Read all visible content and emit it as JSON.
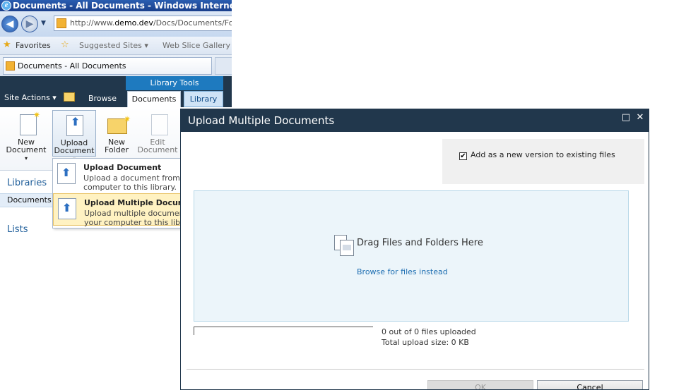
{
  "browser": {
    "title": "Documents - All Documents - Windows Internet Explorer",
    "address": {
      "prefix": "http://www.",
      "domain": "demo.dev",
      "path": "/Docs/Documents/Forms/"
    },
    "favorites": {
      "label": "Favorites",
      "suggested": "Suggested Sites",
      "webslice": "Web Slice Gallery"
    },
    "tab": {
      "label": "Documents - All Documents"
    }
  },
  "ribbon": {
    "site_actions": "Site Actions",
    "contextual_group": "Library Tools",
    "tabs": {
      "browse": "Browse",
      "documents": "Documents",
      "library": "Library"
    },
    "buttons": {
      "new_document": [
        "New",
        "Document"
      ],
      "upload_document": [
        "Upload",
        "Document"
      ],
      "new_folder": [
        "New",
        "Folder"
      ],
      "edit_document": [
        "Edit",
        "Document"
      ]
    },
    "dropdown_caret": "▾"
  },
  "left_nav": {
    "libraries": "Libraries",
    "documents": "Documents",
    "lists": "Lists"
  },
  "upload_menu": {
    "items": [
      {
        "title": "Upload Document",
        "desc1": "Upload a document from your",
        "desc2": "computer to this library."
      },
      {
        "title": "Upload Multiple Documents",
        "desc1": "Upload multiple documents from",
        "desc2": "your computer to this library."
      }
    ]
  },
  "dialog": {
    "title": "Upload Multiple Documents",
    "maximize_icon": "□",
    "close_icon": "✕",
    "version_checkbox": {
      "checked": true,
      "label": "Add as a new version to existing files"
    },
    "drop_zone": {
      "title": "Drag Files and Folders Here",
      "browse_link": "Browse for files instead"
    },
    "progress": {
      "value": 0,
      "count_text": "0 out of 0 files uploaded",
      "size_text": "Total upload size: 0 KB"
    },
    "buttons": {
      "ok": "OK",
      "cancel": "Cancel"
    }
  }
}
